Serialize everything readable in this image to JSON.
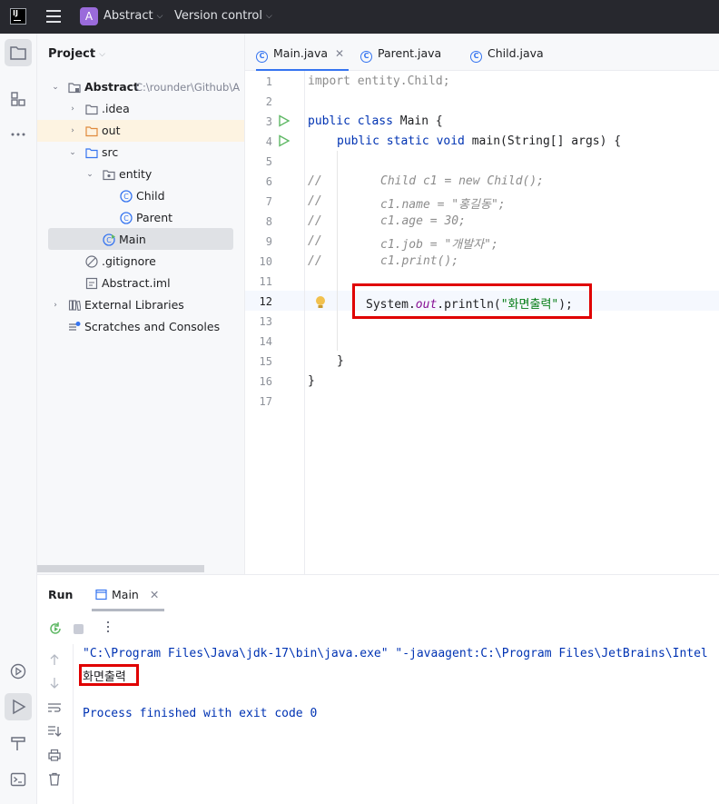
{
  "titlebar": {
    "logo_text": "IJ",
    "project_badge": "A",
    "project_name": "Abstract",
    "vcs_label": "Version control"
  },
  "project_panel": {
    "title": "Project",
    "tree": [
      {
        "label": "Abstract",
        "path": "C:\\rounder\\Github\\A"
      },
      {
        "label": ".idea"
      },
      {
        "label": "out"
      },
      {
        "label": "src"
      },
      {
        "label": "entity"
      },
      {
        "label": "Child"
      },
      {
        "label": "Parent"
      },
      {
        "label": "Main"
      },
      {
        "label": ".gitignore"
      },
      {
        "label": "Abstract.iml"
      },
      {
        "label": "External Libraries"
      },
      {
        "label": "Scratches and Consoles"
      }
    ]
  },
  "tabs": [
    {
      "label": "Main.java",
      "active": true
    },
    {
      "label": "Parent.java",
      "active": false
    },
    {
      "label": "Child.java",
      "active": false
    }
  ],
  "editor": {
    "line_numbers": [
      "1",
      "2",
      "3",
      "4",
      "5",
      "6",
      "7",
      "8",
      "9",
      "10",
      "11",
      "12",
      "13",
      "14",
      "15",
      "16",
      "17"
    ],
    "lines": {
      "l1": "import entity.Child;",
      "l3_kw": "public class ",
      "l3_rest": "Main {",
      "l4_kw": "public static void ",
      "l4_rest": "main(String[] args) {",
      "l6_slash": "//",
      "l6": "Child c1 = new Child();",
      "l7_slash": "//",
      "l7": "c1.name = \"홍길동\";",
      "l8_slash": "//",
      "l8": "c1.age = 30;",
      "l9_slash": "//",
      "l9": "c1.job = \"개발자\";",
      "l10_slash": "//",
      "l10": "c1.print();",
      "l12_a": "System.",
      "l12_b": "out",
      "l12_c": ".println(",
      "l12_d": "\"화면출력\"",
      "l12_e": ");",
      "l15": "}",
      "l16": "}"
    }
  },
  "run_panel": {
    "title": "Run",
    "tab_label": "Main",
    "console": {
      "command": "\"C:\\Program Files\\Java\\jdk-17\\bin\\java.exe\" \"-javaagent:C:\\Program Files\\JetBrains\\Intel",
      "output": "화면출력",
      "exit": "Process finished with exit code 0"
    }
  },
  "colors": {
    "accent": "#3574f0",
    "highlight_box": "#e00000",
    "keyword": "#0033b3",
    "string": "#067d17",
    "titlebar_bg": "#27282e"
  }
}
